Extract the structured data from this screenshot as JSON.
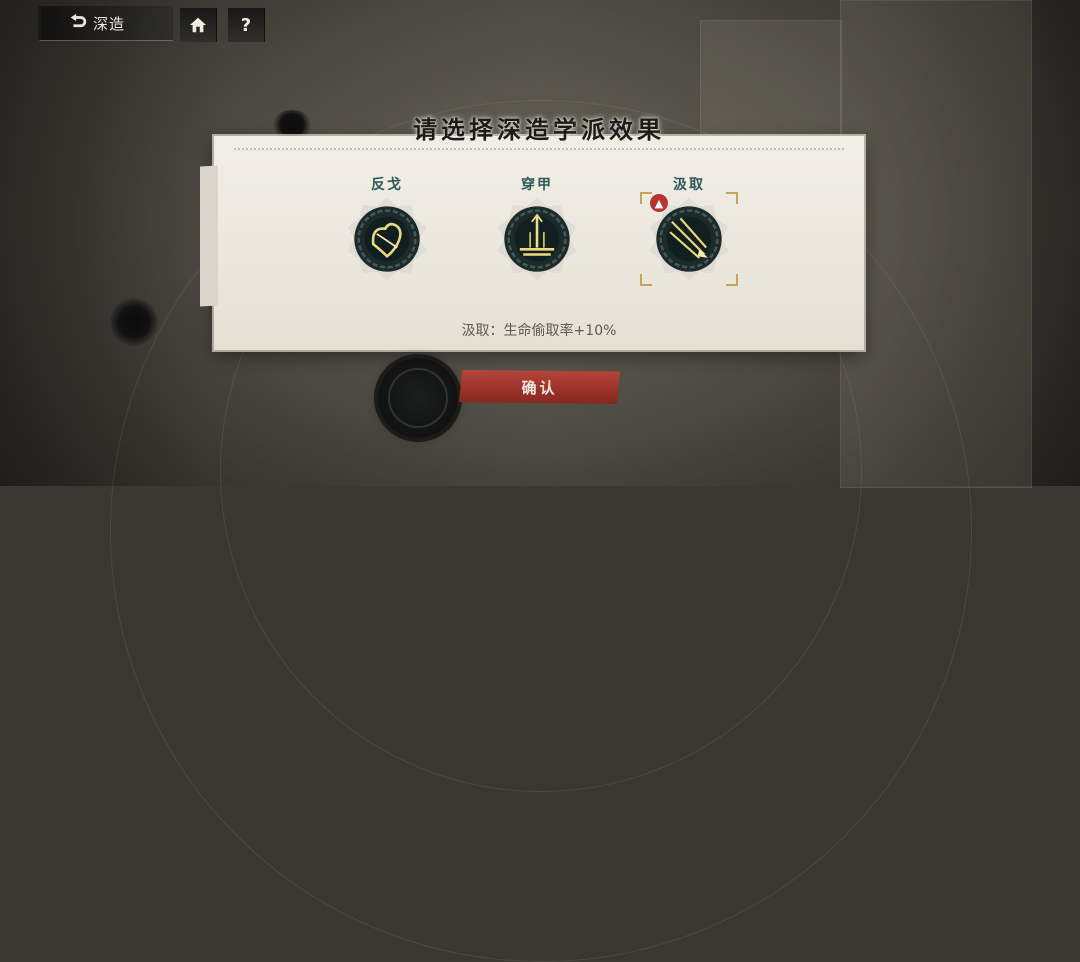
{
  "header": {
    "back_label": "深造",
    "home_icon": "home-icon",
    "help_label": "?"
  },
  "panel": {
    "title": "请选择深造学派效果",
    "options": [
      {
        "label": "反戈",
        "icon": "counter-strike-emblem-icon",
        "selected": false
      },
      {
        "label": "穿甲",
        "icon": "armor-pierce-emblem-icon",
        "selected": false
      },
      {
        "label": "汲取",
        "icon": "lifesteal-emblem-icon",
        "selected": true
      }
    ],
    "description": "汲取：生命偷取率+10%"
  },
  "footer": {
    "confirm_label": "确认"
  },
  "colors": {
    "accent_teal": "#2d5a55",
    "confirm_red": "#9c3128",
    "gold": "#e2c46e"
  }
}
